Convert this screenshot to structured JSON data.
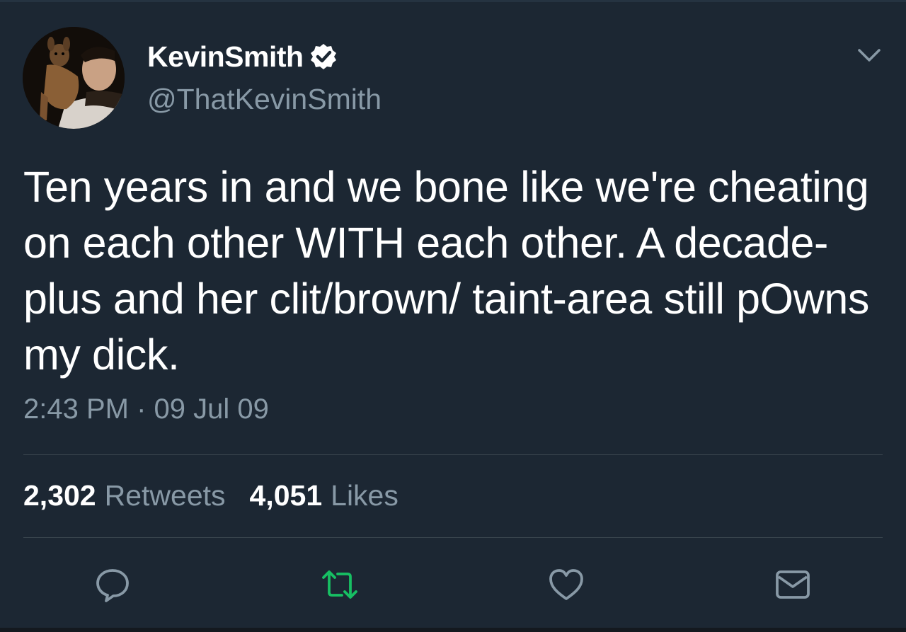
{
  "author": {
    "display_name": "KevinSmith",
    "handle": "@ThatKevinSmith",
    "verified": true
  },
  "tweet": {
    "text": "Ten years in and we bone like we're cheating on each other WITH each other. A decade-plus and her clit/brown/ taint-area still pOwns my dick.",
    "timestamp": "2:43 PM · 09 Jul 09"
  },
  "stats": {
    "retweets_count": "2,302",
    "retweets_label": "Retweets",
    "likes_count": "4,051",
    "likes_label": "Likes"
  },
  "actions": [
    {
      "name": "reply",
      "icon": "reply-icon"
    },
    {
      "name": "retweet",
      "icon": "retweet-icon",
      "active": true
    },
    {
      "name": "like",
      "icon": "heart-icon"
    },
    {
      "name": "direct-message",
      "icon": "envelope-icon"
    }
  ],
  "colors": {
    "background": "#1c2733",
    "text": "#ffffff",
    "secondary_text": "#8899a6",
    "retweet_active": "#17bf63",
    "divider": "#38444d"
  }
}
